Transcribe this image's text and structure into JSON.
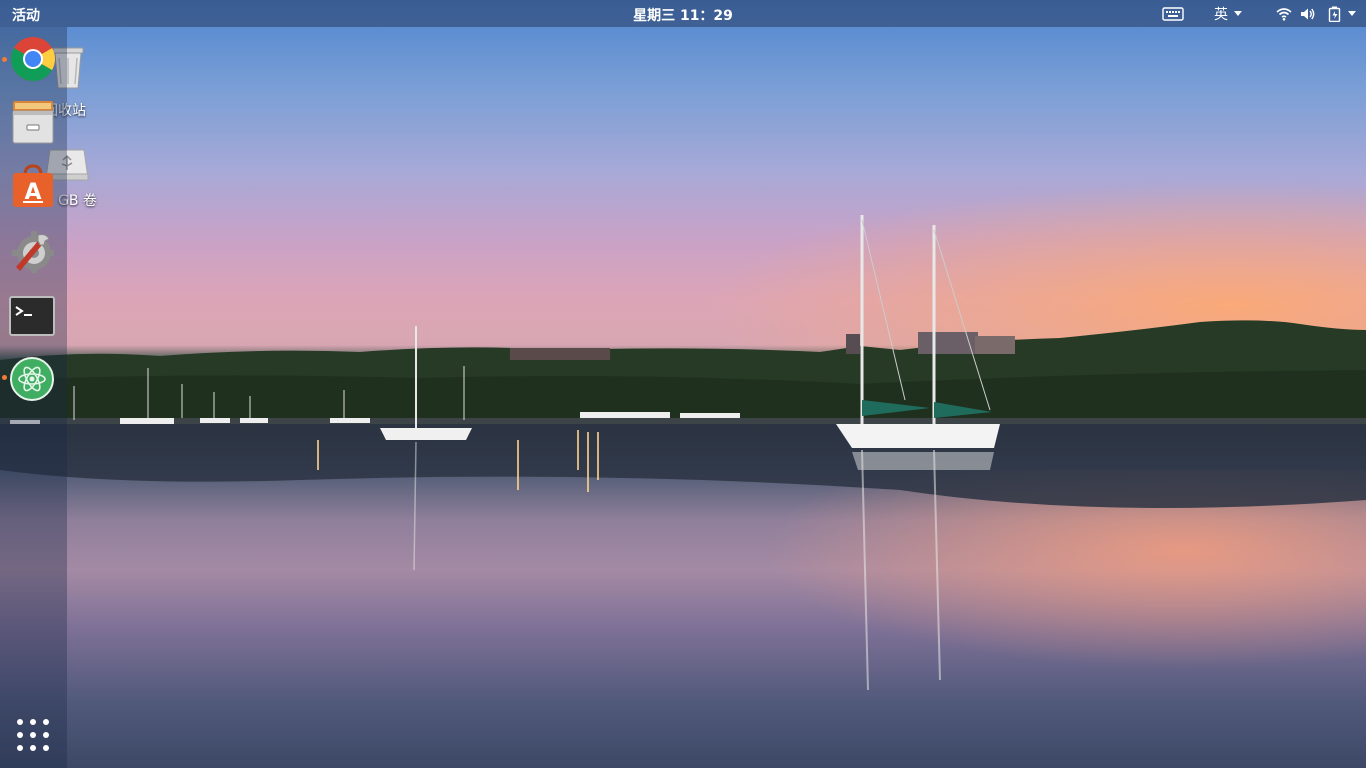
{
  "topbar": {
    "activities_label": "活动",
    "clock": "星期三 11：29",
    "input_method": "英"
  },
  "desktop": {
    "icons": [
      {
        "label": "回收站",
        "icon": "trash-icon"
      },
      {
        "label": "GB 卷",
        "icon": "usb-drive-icon"
      }
    ]
  },
  "dock": {
    "apps": [
      {
        "name": "Google Chrome",
        "icon": "chrome-icon",
        "running": true
      },
      {
        "name": "Files",
        "icon": "file-manager-icon",
        "running": false
      },
      {
        "name": "Software",
        "icon": "software-store-icon",
        "running": false
      },
      {
        "name": "Settings",
        "icon": "settings-tools-icon",
        "running": false
      },
      {
        "name": "Terminal",
        "icon": "terminal-icon",
        "running": false
      },
      {
        "name": "Atom",
        "icon": "atom-icon",
        "running": true
      }
    ],
    "show_apps_icon": "app-grid-icon"
  },
  "colors": {
    "running_indicator": "#f57a32",
    "topbar_bg": "#283c64",
    "software_orange": "#e8612a"
  }
}
